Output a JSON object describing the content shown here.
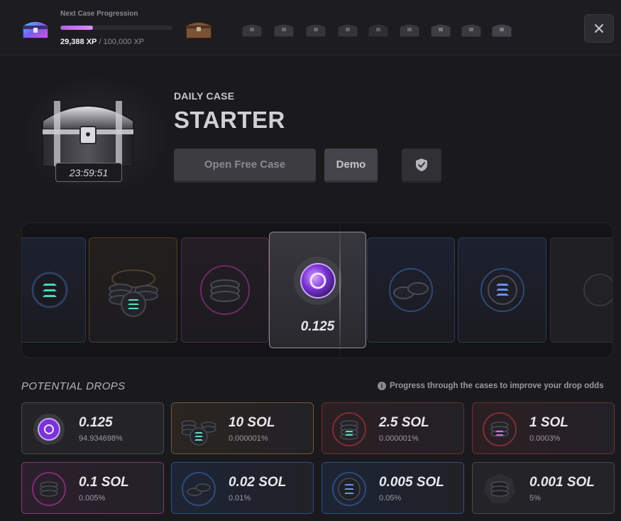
{
  "progression": {
    "label": "Next Case Progression",
    "xp_current": "29,388 XP",
    "xp_target": "/ 100,000 XP",
    "progress_fraction": 0.29388
  },
  "case": {
    "kind": "DAILY CASE",
    "name": "STARTER",
    "timer": "23:59:51",
    "open_label": "Open Free Case",
    "demo_label": "Demo"
  },
  "reel": {
    "highlight_value": "0.125"
  },
  "drops": {
    "title": "POTENTIAL DROPS",
    "hint": "Progress through the cases to improve your drop odds",
    "hint_icon": "info-icon",
    "items": [
      {
        "name": "0.125",
        "odds": "94.934698%",
        "tier": "grey",
        "icon": "purple-token-icon"
      },
      {
        "name": "10 SOL",
        "odds": "0.000001%",
        "tier": "gold",
        "icon": "sol-coin-pile-icon"
      },
      {
        "name": "2.5 SOL",
        "odds": "0.000001%",
        "tier": "red",
        "icon": "sol-coin-stack-icon"
      },
      {
        "name": "1 SOL",
        "odds": "0.0003%",
        "tier": "red",
        "icon": "sol-coin-stack-icon"
      },
      {
        "name": "0.1 SOL",
        "odds": "0.005%",
        "tier": "pink",
        "icon": "sol-coin-stack-icon"
      },
      {
        "name": "0.02 SOL",
        "odds": "0.01%",
        "tier": "blue",
        "icon": "sol-coins-icon"
      },
      {
        "name": "0.005 SOL",
        "odds": "0.05%",
        "tier": "blue",
        "icon": "sol-coin-icon"
      },
      {
        "name": "0.001 SOL",
        "odds": "5%",
        "tier": "grey",
        "icon": "coin-stack-icon"
      }
    ]
  },
  "colors": {
    "accent_purple": "#b15ee8",
    "background": "#1a191c",
    "gold": "#6e5c3a",
    "red": "#6b2f35",
    "pink": "#7a3c75",
    "blue": "#2f4f8a"
  }
}
